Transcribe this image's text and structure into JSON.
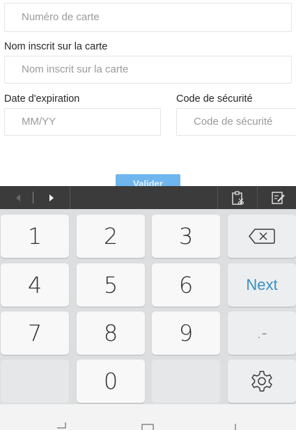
{
  "form": {
    "card_number_placeholder": "Numéro de carte",
    "name_label": "Nom inscrit sur la carte",
    "name_placeholder": "Nom inscrit sur la carte",
    "expiry_label": "Date d'expiration",
    "expiry_placeholder": "MM/YY",
    "cvv_label": "Code de sécurité",
    "cvv_placeholder": "Code de sécurité",
    "validate_label": "Valider"
  },
  "keyboard": {
    "digits": [
      "1",
      "2",
      "3",
      "4",
      "5",
      "6",
      "7",
      "8",
      "9",
      "0"
    ],
    "next_label": "Next",
    "punct_label": ".-",
    "toolbar_icons": [
      "cursor-left-icon",
      "cursor-right-icon",
      "clipboard-icon",
      "edit-icon"
    ]
  },
  "colors": {
    "accent": "#3a8fc5",
    "button": "#6fb6ef",
    "toolbar": "#3b3b3b",
    "keyboard_bg": "#dcdee0"
  }
}
